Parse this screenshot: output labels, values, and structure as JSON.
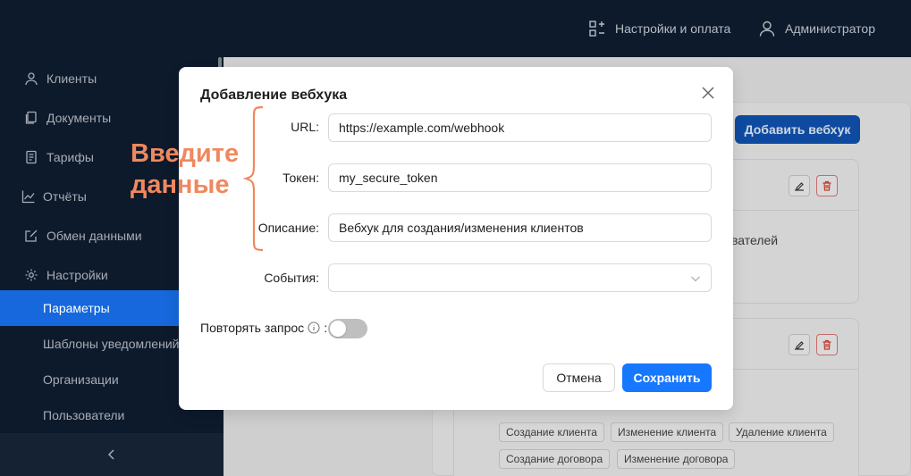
{
  "header": {
    "settings_label": "Настройки и оплата",
    "user_label": "Администратор"
  },
  "sidebar": {
    "items": [
      {
        "label": "Клиенты",
        "icon": "user-icon"
      },
      {
        "label": "Документы",
        "icon": "documents-icon"
      },
      {
        "label": "Тарифы",
        "icon": "tariffs-icon"
      },
      {
        "label": "Отчёты",
        "icon": "chart-icon"
      },
      {
        "label": "Обмен данными",
        "icon": "edit-square-icon"
      },
      {
        "label": "Настройки",
        "icon": "gear-icon"
      }
    ],
    "subitems": [
      {
        "label": "Параметры",
        "active": true
      },
      {
        "label": "Шаблоны уведомлений",
        "active": false
      },
      {
        "label": "Организации",
        "active": false
      },
      {
        "label": "Пользователи",
        "active": false
      }
    ]
  },
  "background": {
    "add_button": "Добавить вебхук",
    "partial_text": "вателей",
    "tags": [
      "Создание клиента",
      "Изменение клиента",
      "Удаление клиента",
      "Создание договора",
      "Изменение договора"
    ]
  },
  "annotation": {
    "line1": "Введите",
    "line2": "данные",
    "color": "#f0885e"
  },
  "modal": {
    "title": "Добавление вебхука",
    "url_label": "URL",
    "url_value": "https://example.com/webhook",
    "token_label": "Токен",
    "token_value": "my_secure_token",
    "description_label": "Описание",
    "description_value": "Вебхук для создания/изменения клиентов",
    "events_label": "События",
    "events_value": "",
    "repeat_label": "Повторять запрос",
    "repeat_enabled": false,
    "cancel_label": "Отмена",
    "save_label": "Сохранить",
    "accent": "#1677ff"
  }
}
